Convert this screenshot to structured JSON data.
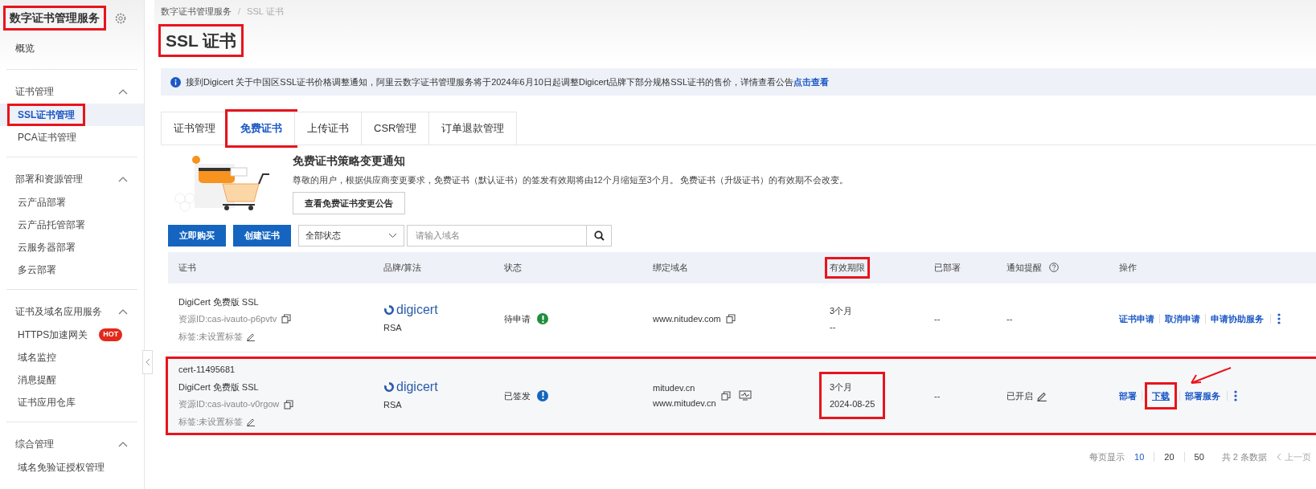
{
  "sidebar": {
    "title": "数字证书管理服务",
    "title_highlighted": true,
    "overview": "概览",
    "groups": [
      {
        "label": "证书管理",
        "expanded": true,
        "items": [
          {
            "label": "SSL证书管理",
            "selected": true,
            "highlighted": true
          },
          {
            "label": "PCA证书管理",
            "selected": false,
            "highlighted": false
          }
        ]
      },
      {
        "label": "部署和资源管理",
        "expanded": true,
        "items": [
          {
            "label": "云产品部署",
            "selected": false,
            "highlighted": false
          },
          {
            "label": "云产品托管部署",
            "selected": false,
            "highlighted": false
          },
          {
            "label": "云服务器部署",
            "selected": false,
            "highlighted": false
          },
          {
            "label": "多云部署",
            "selected": false,
            "highlighted": false
          }
        ]
      },
      {
        "label": "证书及域名应用服务",
        "expanded": true,
        "items": [
          {
            "label": "HTTPS加速网关",
            "badge": "HOT",
            "selected": false,
            "highlighted": false
          },
          {
            "label": "域名监控",
            "selected": false,
            "highlighted": false
          },
          {
            "label": "消息提醒",
            "selected": false,
            "highlighted": false
          },
          {
            "label": "证书应用仓库",
            "selected": false,
            "highlighted": false
          }
        ]
      },
      {
        "label": "综合管理",
        "expanded": true,
        "items": [
          {
            "label": "域名免验证授权管理",
            "selected": false,
            "highlighted": false
          }
        ]
      }
    ]
  },
  "breadcrumb": {
    "items": [
      "数字证书管理服务",
      "SSL 证书"
    ],
    "separator": "/"
  },
  "page_title": {
    "text": "SSL 证书",
    "highlighted": true
  },
  "notice": {
    "text": "接到Digicert 关于中国区SSL证书价格调整通知，阿里云数字证书管理服务将于2024年6月10日起调整Digicert品牌下部分规格SSL证书的售价，详情查看公告",
    "link": "点击查看"
  },
  "tabs": [
    {
      "label": "证书管理",
      "selected": false,
      "highlighted": false
    },
    {
      "label": "免费证书",
      "selected": true,
      "highlighted": true
    },
    {
      "label": "上传证书",
      "selected": false,
      "highlighted": false
    },
    {
      "label": "CSR管理",
      "selected": false,
      "highlighted": false
    },
    {
      "label": "订单退款管理",
      "selected": false,
      "highlighted": false
    }
  ],
  "promo": {
    "title": "免费证书策略变更通知",
    "body": "尊敬的用户，根据供应商变更要求，免费证书（默认证书）的签发有效期将由12个月缩短至3个月。 免费证书（升级证书）的有效期不会改变。",
    "button": "查看免费证书变更公告"
  },
  "toolbar": {
    "buttons": [
      "立即购买",
      "创建证书"
    ],
    "status_select": "全部状态",
    "search": {
      "placeholder": "请输入域名"
    }
  },
  "table": {
    "columns": [
      {
        "label": "证书",
        "highlighted": false,
        "help": false
      },
      {
        "label": "品牌/算法",
        "highlighted": false,
        "help": false
      },
      {
        "label": "状态",
        "highlighted": false,
        "help": false
      },
      {
        "label": "绑定域名",
        "highlighted": false,
        "help": false
      },
      {
        "label": "有效期限",
        "highlighted": true,
        "help": false
      },
      {
        "label": "已部署",
        "highlighted": false,
        "help": false
      },
      {
        "label": "通知提醒",
        "highlighted": false,
        "help": true
      },
      {
        "label": "操作",
        "highlighted": false,
        "help": false
      }
    ],
    "rows": [
      {
        "highlighted": false,
        "name_lines": [
          "DigiCert 免费版 SSL"
        ],
        "resource_id": "资源ID:cas-ivauto-p6pvtv",
        "tag": "标签:未设置标签",
        "brand": "digicert",
        "algorithm": "RSA",
        "status": "待申请",
        "color": "#1e8e3e",
        "domains": [
          "www.nitudev.com"
        ],
        "monitor": false,
        "validity": [
          "3个月",
          "--"
        ],
        "validity_highlighted": false,
        "deployed": "--",
        "notify": "--",
        "notify_editable": false,
        "actions": [
          {
            "label": "证书申请",
            "highlighted": false
          },
          {
            "label": "取消申请",
            "highlighted": false
          },
          {
            "label": "申请协助服务",
            "highlighted": false
          }
        ]
      },
      {
        "highlighted": true,
        "name_lines": [
          "cert-11495681",
          "DigiCert 免费版 SSL"
        ],
        "resource_id": "资源ID:cas-ivauto-v0rgow",
        "tag": "标签:未设置标签",
        "brand": "digicert",
        "algorithm": "RSA",
        "status": "已签发",
        "color": "#1565c0",
        "domains": [
          "mitudev.cn",
          "www.mitudev.cn"
        ],
        "monitor": true,
        "validity": [
          "3个月",
          "2024-08-25"
        ],
        "validity_highlighted": true,
        "deployed": "--",
        "notify": "已开启",
        "notify_editable": true,
        "actions": [
          {
            "label": "部署",
            "highlighted": false
          },
          {
            "label": "下载",
            "highlighted": true
          },
          {
            "label": "部署服务",
            "highlighted": false
          }
        ]
      }
    ]
  },
  "annotation_arrow": true,
  "pagination": {
    "label": "每页显示",
    "sizes": [
      {
        "label": "10",
        "selected": true
      },
      {
        "label": "20",
        "selected": false
      },
      {
        "label": "50",
        "selected": false
      }
    ],
    "total": "共 2 条数据",
    "prev": "上一页"
  }
}
